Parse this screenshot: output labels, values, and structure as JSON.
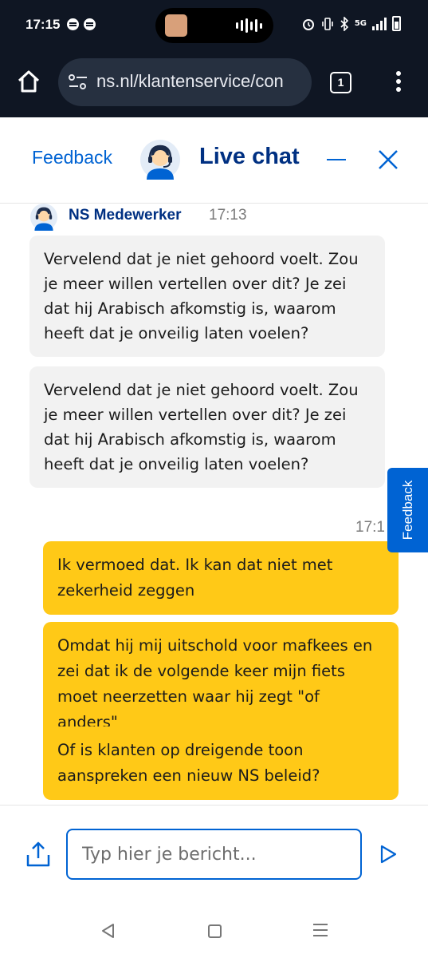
{
  "status_bar": {
    "time": "17:15",
    "network": "5G"
  },
  "browser": {
    "url": "ns.nl/klantenservice/con",
    "tab_count": "1"
  },
  "chat_header": {
    "feedback_label": "Feedback",
    "title": "Live chat"
  },
  "agent": {
    "name": "NS Medewerker",
    "time": "17:13"
  },
  "messages_in": [
    "Vervelend dat je niet gehoord voelt. Zou je meer willen vertellen over dit? Je zei dat hij Arabisch afkomstig is, waarom heeft dat je onveilig laten voelen?",
    "Vervelend dat je niet gehoord voelt. Zou je meer willen vertellen over dit? Je zei dat hij Arabisch afkomstig is, waarom heeft dat je onveilig laten voelen?"
  ],
  "user_time": "17:1",
  "messages_out": [
    "Ik vermoed dat. Ik kan dat niet met zekerheid zeggen",
    "Omdat hij mij uitschold voor mafkees en zei dat ik de volgende keer mijn fiets moet neerzetten waar hij zegt \"of anders\"",
    "Of is klanten op dreigende toon aanspreken een nieuw NS beleid?"
  ],
  "feedback_tab_label": "Feedback",
  "composer": {
    "placeholder": "Typ hier je bericht..."
  },
  "colors": {
    "ns_blue": "#003082",
    "link_blue": "#0063d3",
    "ns_yellow": "#ffc917",
    "agent_bubble": "#f2f2f2"
  },
  "icons": [
    "home-icon",
    "tune-icon",
    "menu-icon",
    "headset-avatar-icon",
    "minimize-icon",
    "close-icon",
    "share-icon",
    "send-icon",
    "back-icon",
    "recents-icon"
  ]
}
